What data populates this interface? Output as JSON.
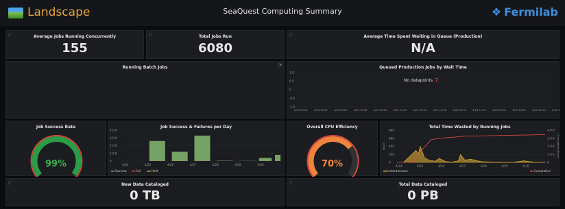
{
  "header": {
    "app_name": "Landscape",
    "dashboard_title": "SeaQuest Computing Summary",
    "brand": "Fermilab"
  },
  "panels": {
    "avg_jobs": {
      "title": "Average Jobs Running Concurrently",
      "value": "155"
    },
    "total_jobs": {
      "title": "Total Jobs Run",
      "value": "6080"
    },
    "avg_wait": {
      "title": "Average Time Spent Waiting in Queue (Production)",
      "value": "N/A"
    },
    "running_batch": {
      "title": "Running Batch Jobs"
    },
    "queued": {
      "title": "Queued Production Jobs by Wait Time",
      "no_data": "No datapoints",
      "y_ticks": [
        "1.0",
        "0.5",
        "0",
        "-0.5",
        "-1.0"
      ],
      "x_ticks": [
        "4/24 00:00",
        "4/24 12:00",
        "4/25 00:00",
        "4/25 12:00",
        "4/26 00:00",
        "4/26 12:00",
        "4/27 00:00",
        "4/27 12:00",
        "4/28 00:00",
        "4/28 12:00",
        "4/29 00:00",
        "4/29 12:00",
        "4/30 00:00",
        "4/30 12:00"
      ]
    },
    "success_rate": {
      "title": "Job Success Rate",
      "value": "99%",
      "fraction": 0.99
    },
    "success_failures": {
      "title": "Job Success & Failures per Day",
      "legend": [
        "Success",
        "Fail",
        "Held"
      ],
      "y_ticks": [
        "4.0 K",
        "3.0 K",
        "2.0 K",
        "1.0 K",
        "0"
      ],
      "x_ticks": [
        "4/24",
        "4/25",
        "4/26",
        "4/27",
        "4/28",
        "4/29",
        "4/30"
      ]
    },
    "cpu_eff": {
      "title": "Overall CPU Efficiency",
      "value": "70%",
      "fraction": 0.7
    },
    "time_wasted": {
      "title": "Total Time Wasted by Running Jobs",
      "legend": [
        "Instantaneous",
        "Cumulative"
      ],
      "y_left_ticks": [
        "800",
        "600",
        "400",
        "200",
        "0"
      ],
      "y_right_ticks": [
        "4.0 K",
        "3.0 K",
        "2.0 K",
        "1.0 K",
        "0"
      ],
      "x_ticks": [
        "4/24",
        "4/25",
        "4/26",
        "4/27",
        "4/28",
        "4/29",
        "4/30"
      ],
      "y_left_label": "Hours",
      "y_right_label": "Cumulative Hours"
    },
    "new_data": {
      "title": "New Data Cataloged",
      "value": "0 TB"
    },
    "total_data": {
      "title": "Total Data Cataloged",
      "value": "0 PB"
    }
  },
  "colors": {
    "success": "#7eb26d",
    "fail": "#e24d42",
    "held": "#eab839",
    "gauge_green": "#299c46",
    "gauge_orange": "#ef843c",
    "gauge_red": "#d44a3a"
  },
  "chart_data": [
    {
      "type": "bar",
      "title": "Job Success & Failures per Day",
      "categories": [
        "4/24",
        "4/25",
        "4/26",
        "4/27",
        "4/28",
        "4/29",
        "4/30"
      ],
      "x": [
        0.5,
        1.5,
        2.5,
        3.5,
        4.5,
        5.5,
        6.3,
        6.85
      ],
      "series": [
        {
          "name": "Success",
          "values": [
            0,
            2600,
            1200,
            3300,
            40,
            20,
            400,
            800
          ]
        },
        {
          "name": "Fail",
          "values": [
            0,
            20,
            10,
            20,
            0,
            0,
            5,
            5
          ]
        },
        {
          "name": "Held",
          "values": [
            0,
            0,
            0,
            0,
            0,
            0,
            0,
            0
          ]
        }
      ],
      "ylim": [
        0,
        4000
      ]
    },
    {
      "type": "line",
      "title": "Total Time Wasted by Running Jobs",
      "x_range": [
        "4/24",
        "4/30"
      ],
      "series": [
        {
          "name": "Instantaneous",
          "x": [
            0.3,
            0.6,
            0.9,
            1.0,
            1.1,
            1.3,
            1.5,
            1.8,
            2.0,
            2.3,
            2.6,
            2.9,
            3.0,
            3.2,
            3.5,
            3.8,
            4.0,
            4.3,
            4.6,
            5.0,
            5.5,
            6.0,
            6.5,
            7.0
          ],
          "values": [
            0,
            150,
            300,
            200,
            400,
            120,
            60,
            30,
            100,
            20,
            10,
            40,
            200,
            60,
            80,
            40,
            20,
            15,
            10,
            8,
            5,
            40,
            5,
            5
          ]
        },
        {
          "name": "Cumulative",
          "x": [
            0.0,
            0.8,
            1.0,
            1.6,
            2.0,
            2.5,
            3.0,
            3.05,
            3.5,
            4.0,
            5.0,
            6.0,
            7.0
          ],
          "values": [
            0,
            50,
            1000,
            2800,
            3000,
            3100,
            3200,
            3250,
            3280,
            3300,
            3350,
            3400,
            3450
          ]
        }
      ],
      "ylim_left": [
        0,
        800
      ],
      "ylim_right": [
        0,
        4000
      ]
    }
  ]
}
